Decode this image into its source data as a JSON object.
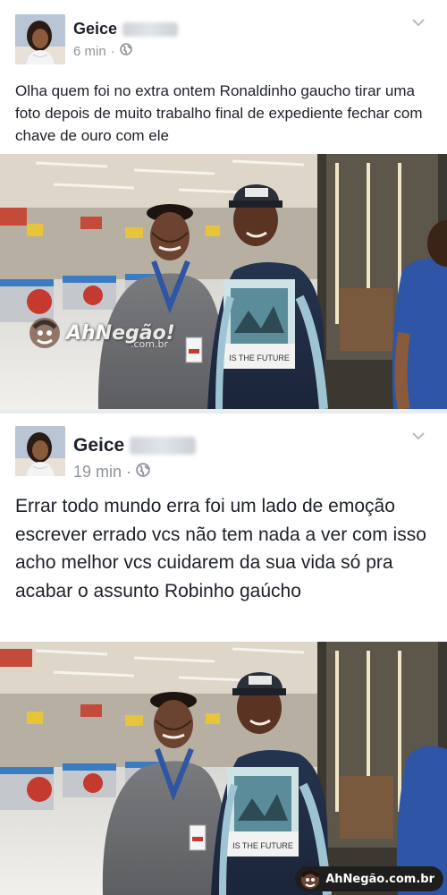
{
  "colors": {
    "name_text": "#1d2129",
    "meta_text": "#90949c",
    "feed_bg": "#e9ebee",
    "card_bg": "#ffffff"
  },
  "posts": [
    {
      "author_first": "Geice",
      "time": "6 min",
      "separator": "·",
      "privacy_icon": "globe-icon",
      "menu_icon": "chevron-down-icon",
      "text": "Olha quem  foi no extra ontem Ronaldinho gaucho tirar uma  foto  depois de muito trabalho  final de expediente  fechar com chave de ouro com ele",
      "image": {
        "shirt_print": "IS THE FUTURE",
        "watermark": "AhNegão!",
        "watermark_sub": ".com.br"
      }
    },
    {
      "author_first": "Geice",
      "time": "19 min",
      "separator": "·",
      "privacy_icon": "globe-icon",
      "menu_icon": "chevron-down-icon",
      "text": "Errar todo mundo erra foi um lado de emoção  escrever errado vcs não  tem nada a ver com isso  acho melhor  vcs cuidarem  da sua vida só  pra acabar o assunto Robinho gaúcho",
      "image": {
        "shirt_print": "IS THE FUTURE",
        "badge": "AhNegão.com.br"
      }
    }
  ]
}
